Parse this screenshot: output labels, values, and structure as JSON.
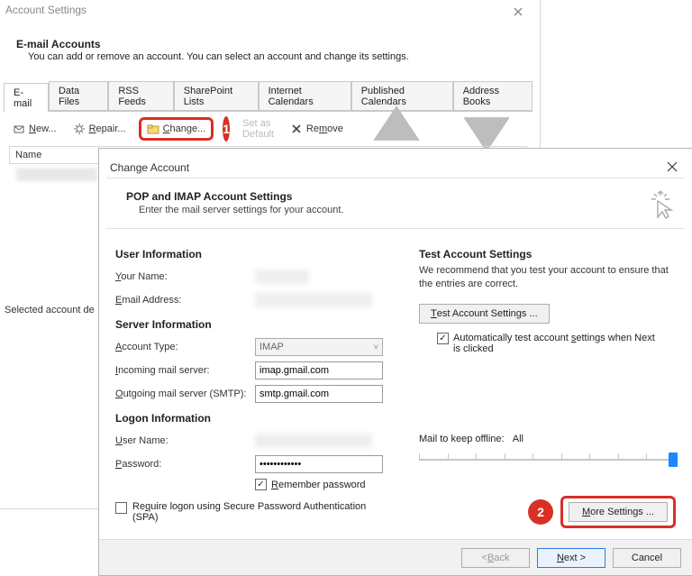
{
  "as": {
    "title": "Account Settings",
    "heading": "E-mail Accounts",
    "sub": "You can add or remove an account. You can select an account and change its settings.",
    "tabs": [
      "E-mail",
      "Data Files",
      "RSS Feeds",
      "SharePoint Lists",
      "Internet Calendars",
      "Published Calendars",
      "Address Books"
    ],
    "toolbar": {
      "new": "New...",
      "repair": "Repair...",
      "change": "Change...",
      "setdefault": "Set as Default",
      "remove": "Remove"
    },
    "list_col": "Name",
    "bottom": "Selected account de"
  },
  "annot": {
    "one": "1",
    "two": "2"
  },
  "ca": {
    "title": "Change Account",
    "head": "POP and IMAP Account Settings",
    "sub": "Enter the mail server settings for your account.",
    "left": {
      "user_h": "User Information",
      "yourname": "Your Name:",
      "email": "Email Address:",
      "server_h": "Server Information",
      "accttype": "Account Type:",
      "accttype_val": "IMAP",
      "incoming": "Incoming mail server:",
      "incoming_val": "imap.gmail.com",
      "outgoing": "Outgoing mail server (SMTP):",
      "outgoing_val": "smtp.gmail.com",
      "logon_h": "Logon Information",
      "username": "User Name:",
      "password": "Password:",
      "password_val": "************",
      "remember": "Remember password",
      "spa": "Require logon using Secure Password Authentication (SPA)"
    },
    "right": {
      "test_h": "Test Account Settings",
      "test_desc": "We recommend that you test your account to ensure that the entries are correct.",
      "test_btn": "Test Account Settings ...",
      "auto": "Automatically test account settings when Next is clicked",
      "offline_lbl": "Mail to keep offline:",
      "offline_val": "All",
      "more": "More Settings ..."
    },
    "footer": {
      "back": "< Back",
      "next": "Next >",
      "cancel": "Cancel"
    }
  }
}
